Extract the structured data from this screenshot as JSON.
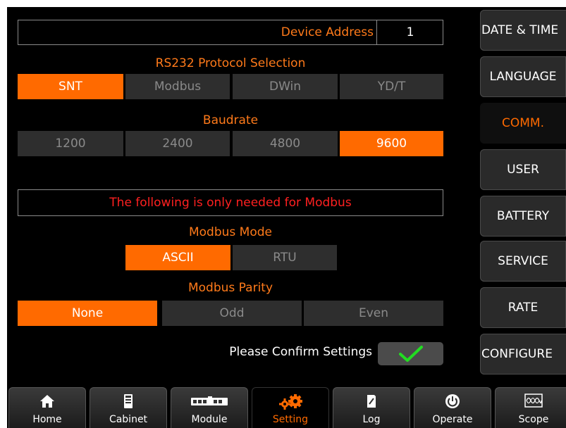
{
  "device_address": {
    "label": "Device Address",
    "value": "1"
  },
  "protocol": {
    "title": "RS232 Protocol Selection",
    "options": [
      "SNT",
      "Modbus",
      "DWin",
      "YD/T"
    ],
    "selected": "SNT"
  },
  "baudrate": {
    "title": "Baudrate",
    "options": [
      "1200",
      "2400",
      "4800",
      "9600"
    ],
    "selected": "9600"
  },
  "modbus_notice": "The following is only needed for Modbus",
  "modbus_mode": {
    "title": "Modbus Mode",
    "options": [
      "ASCII",
      "RTU"
    ],
    "selected": "ASCII"
  },
  "modbus_parity": {
    "title": "Modbus Parity",
    "options": [
      "None",
      "Odd",
      "Even"
    ],
    "selected": "None"
  },
  "confirm": {
    "label": "Please Confirm Settings",
    "icon": "checkmark-icon"
  },
  "sidebar": {
    "items": [
      {
        "label": "DATE & TIME"
      },
      {
        "label": "LANGUAGE"
      },
      {
        "label": "COMM.",
        "active": true
      },
      {
        "label": "USER"
      },
      {
        "label": "BATTERY"
      },
      {
        "label": "SERVICE"
      },
      {
        "label": "RATE"
      },
      {
        "label": "CONFIGURE"
      }
    ]
  },
  "bottom_tabs": [
    {
      "label": "Home",
      "icon": "home-icon"
    },
    {
      "label": "Cabinet",
      "icon": "cabinet-icon"
    },
    {
      "label": "Module",
      "icon": "module-icon"
    },
    {
      "label": "Setting",
      "icon": "gear-icon",
      "active": true
    },
    {
      "label": "Log",
      "icon": "log-icon"
    },
    {
      "label": "Operate",
      "icon": "power-icon"
    },
    {
      "label": "Scope",
      "icon": "scope-icon"
    }
  ],
  "colors": {
    "accent": "#ff6a00",
    "notice_red": "#ff2020",
    "check_green": "#22dd22"
  }
}
